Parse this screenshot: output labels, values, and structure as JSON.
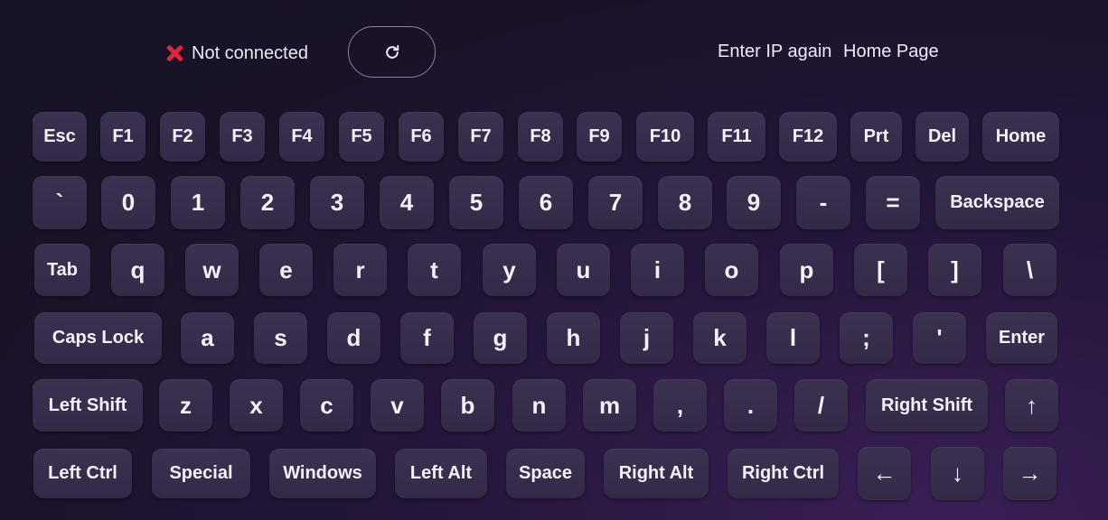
{
  "status": {
    "text": "Not connected",
    "icon": "x-icon"
  },
  "refresh": {
    "icon": "refresh-icon"
  },
  "links": {
    "enter_ip": "Enter IP again",
    "home_page": "Home Page"
  },
  "keyboard": {
    "row1": [
      "Esc",
      "F1",
      "F2",
      "F3",
      "F4",
      "F5",
      "F6",
      "F7",
      "F8",
      "F9",
      "F10",
      "F11",
      "F12",
      "Prt",
      "Del",
      "Home"
    ],
    "row2": [
      "`",
      "0",
      "1",
      "2",
      "3",
      "4",
      "5",
      "6",
      "7",
      "8",
      "9",
      "-",
      "=",
      "Backspace"
    ],
    "row3": [
      "Tab",
      "q",
      "w",
      "e",
      "r",
      "t",
      "y",
      "u",
      "i",
      "o",
      "p",
      "[",
      "]",
      "\\"
    ],
    "row4": [
      "Caps Lock",
      "a",
      "s",
      "d",
      "f",
      "g",
      "h",
      "j",
      "k",
      "l",
      ";",
      "'",
      "Enter"
    ],
    "row5": [
      "Left Shift",
      "z",
      "x",
      "c",
      "v",
      "b",
      "n",
      "m",
      ",",
      ".",
      "/",
      "Right Shift",
      "↑"
    ],
    "row6": [
      "Left Ctrl",
      "Special",
      "Windows",
      "Left Alt",
      "Space",
      "Right Alt",
      "Right Ctrl",
      "←",
      "↓",
      "→"
    ]
  }
}
